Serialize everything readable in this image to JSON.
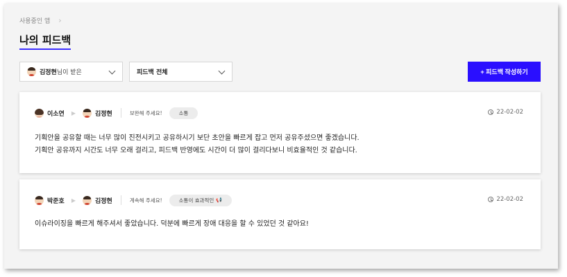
{
  "breadcrumb": {
    "parent": "사용중인 앱",
    "separator": "›"
  },
  "page": {
    "title": "나의 피드백"
  },
  "filters": {
    "user": {
      "name": "김정현",
      "suffix": "님이 받은"
    },
    "type": {
      "selected": "피드백 전체"
    }
  },
  "write_button": {
    "label": "+ 피드백 작성하기"
  },
  "colors": {
    "accent": "#2a0fff",
    "underline": "#3b2cff"
  },
  "feedbacks": [
    {
      "from": "이소연",
      "to": "김정현",
      "arrow": "▶",
      "request": "보완해 주세요!",
      "tag": "소통",
      "tag_icon": "",
      "date": "22-02-02",
      "lines": [
        "기획안을 공유할 때는 너무 많이 진전시키고 공유하시기 보단 초안을 빠르게 잡고 먼저 공유주셨으면 좋겠습니다.",
        "기획안 공유까지 시간도 너무 오래 걸리고, 피드백 반영에도 시간이 더 많이 걸리다보니 비효율적인 것 같습니다."
      ]
    },
    {
      "from": "박준호",
      "to": "김정현",
      "arrow": "▶",
      "request": "계속해 주세요!",
      "tag": "소통이 효과적인",
      "tag_icon": "📢",
      "date": "22-02-02",
      "lines": [
        "이슈라이징을 빠르게 해주셔서 좋았습니다. 덕분에 빠르게 장애 대응을 할 수 있었던 것 같아요!"
      ]
    }
  ]
}
